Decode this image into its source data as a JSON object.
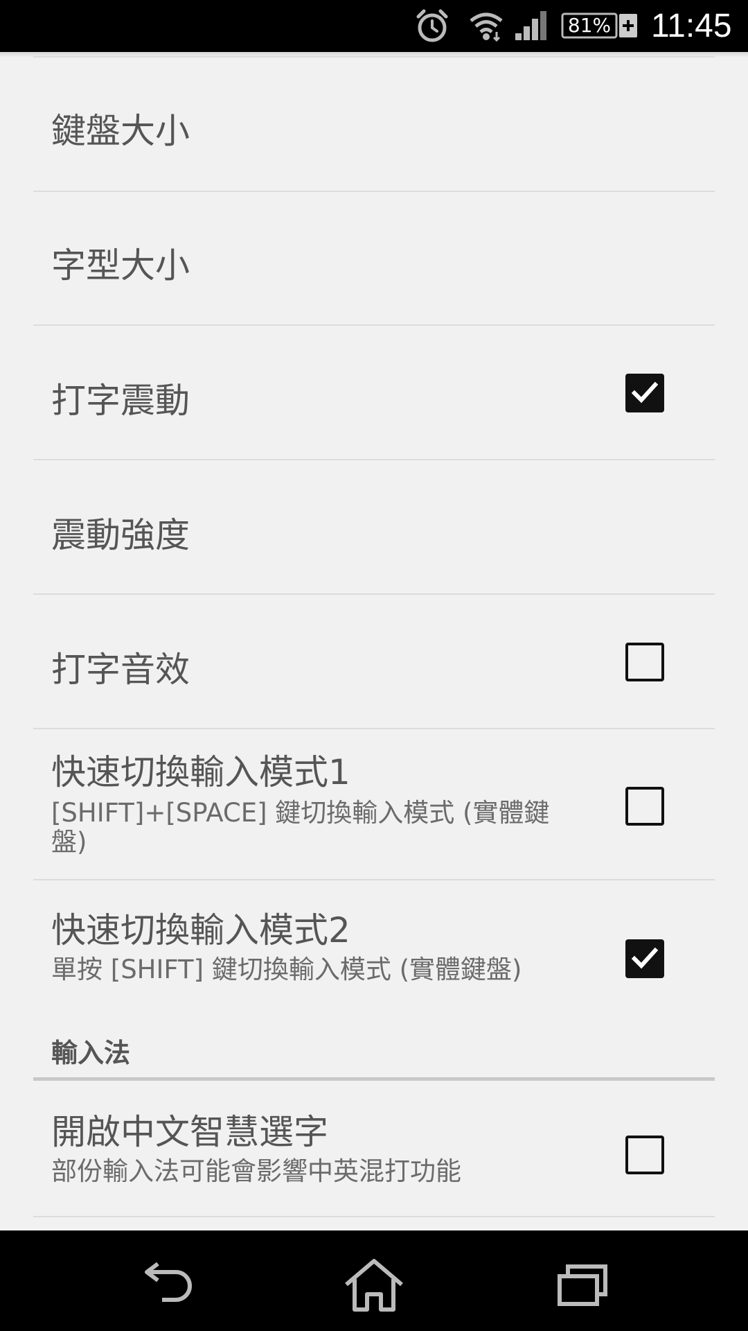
{
  "status_bar": {
    "battery": "81%",
    "time": "11:45"
  },
  "settings": [
    {
      "title": "鍵盤大小",
      "summary": "",
      "checkbox": null
    },
    {
      "title": "字型大小",
      "summary": "",
      "checkbox": null
    },
    {
      "title": "打字震動",
      "summary": "",
      "checkbox": true
    },
    {
      "title": "震動強度",
      "summary": "",
      "checkbox": null
    },
    {
      "title": "打字音效",
      "summary": "",
      "checkbox": false
    },
    {
      "title": "快速切換輸入模式1",
      "summary": "[SHIFT]+[SPACE] 鍵切換輸入模式 (實體鍵盤)",
      "checkbox": false
    },
    {
      "title": "快速切換輸入模式2",
      "summary": "單按 [SHIFT] 鍵切換輸入模式 (實體鍵盤)",
      "checkbox": true
    }
  ],
  "category": "輸入法",
  "category_settings": [
    {
      "title": "開啟中文智慧選字",
      "summary": "部份輸入法可能會影響中英混打功能",
      "checkbox": false
    }
  ],
  "icons": {
    "alarm": "alarm-icon",
    "wifi": "wifi-icon",
    "signal": "signal-icon",
    "back": "back-icon",
    "home": "home-icon",
    "recents": "recents-icon"
  }
}
